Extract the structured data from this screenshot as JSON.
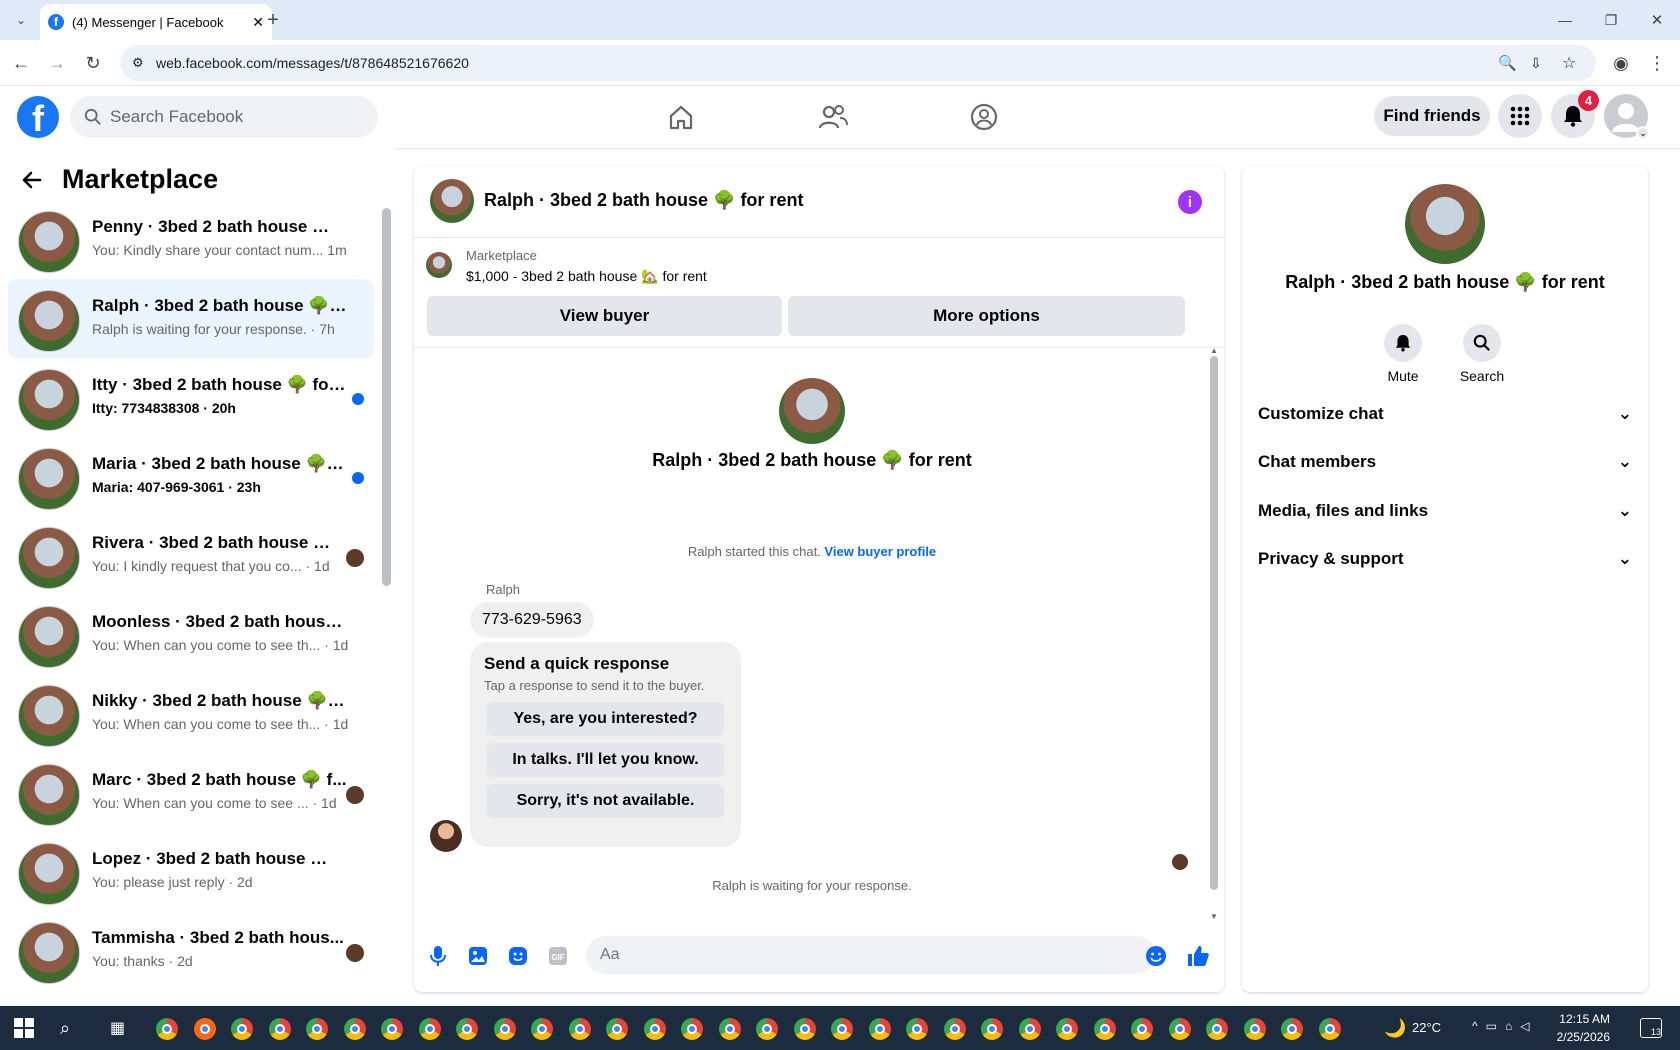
{
  "browser": {
    "tab_title": "(4) Messenger | Facebook",
    "url": "web.facebook.com/messages/t/878648521676620"
  },
  "header": {
    "search_placeholder": "Search Facebook",
    "find_friends": "Find friends",
    "notification_count": "4"
  },
  "sidebar": {
    "title": "Marketplace",
    "conversations": [
      {
        "name": "Penny · 3bed 2 bath house 🌳 fo...",
        "snippet": "You: Kindly share your contact num... 1m",
        "active": false,
        "unread": false,
        "indicator": "none"
      },
      {
        "name": "Ralph · 3bed 2 bath house 🌳 fo...",
        "snippet": "Ralph is waiting for your response. · 7h",
        "active": true,
        "unread": false,
        "indicator": "none"
      },
      {
        "name": "Itty · 3bed 2 bath house 🌳 for...",
        "snippet": "Itty: 7734838308 · 20h",
        "active": false,
        "unread": true,
        "indicator": "dot"
      },
      {
        "name": "Maria · 3bed 2 bath house 🌳 f...",
        "snippet": "Maria: 407-969-3061 · 23h",
        "active": false,
        "unread": true,
        "indicator": "dot"
      },
      {
        "name": "Rivera · 3bed 2 bath house 🌳 ...",
        "snippet": "You: I kindly request that you co... · 1d",
        "active": false,
        "unread": false,
        "indicator": "avatar"
      },
      {
        "name": "Moonless · 3bed 2 bath house ...",
        "snippet": "You: When can you come to see th... · 1d",
        "active": false,
        "unread": false,
        "indicator": "none"
      },
      {
        "name": "Nikky · 3bed 2 bath house 🌳 fo...",
        "snippet": "You: When can you come to see th... · 1d",
        "active": false,
        "unread": false,
        "indicator": "none"
      },
      {
        "name": "Marc · 3bed 2 bath house 🌳 f...",
        "snippet": "You: When can you come to see ... · 1d",
        "active": false,
        "unread": false,
        "indicator": "avatar"
      },
      {
        "name": "Lopez · 3bed 2 bath house 🌳 fo...",
        "snippet": "You: please just reply · 2d",
        "active": false,
        "unread": false,
        "indicator": "none"
      },
      {
        "name": "Tammisha · 3bed 2 bath hous...",
        "snippet": "You: thanks · 2d",
        "active": false,
        "unread": false,
        "indicator": "avatar"
      }
    ]
  },
  "chat": {
    "title": "Ralph · 3bed 2 bath house 🌳 for rent",
    "listing_source": "Marketplace",
    "listing_price": "$1,000 - 3bed 2 bath house 🏡 for rent",
    "view_buyer": "View buyer",
    "more_options": "More options",
    "thread_title": "Ralph · 3bed 2 bath house 🌳 for rent",
    "started_text": "Ralph started this chat.",
    "view_buyer_profile": "View buyer profile",
    "sender_name": "Ralph",
    "phone_message": "773-629-5963",
    "quick_title": "Send a quick response",
    "quick_sub": "Tap a response to send it to the buyer.",
    "quick_responses": [
      "Yes, are you interested?",
      "In talks. I'll let you know.",
      "Sorry, it's not available."
    ],
    "waiting_text": "Ralph is waiting for your response.",
    "composer_placeholder": "Aa"
  },
  "details": {
    "title": "Ralph · 3bed 2 bath house 🌳 for rent",
    "mute": "Mute",
    "search": "Search",
    "sections": [
      "Customize chat",
      "Chat members",
      "Media, files and links",
      "Privacy & support"
    ]
  },
  "taskbar": {
    "temperature": "22°C",
    "time": "12:15 AM",
    "date": "2/25/2026",
    "notification_count": "13"
  },
  "colors": {
    "accent": "#0866ff",
    "info": "#a033ff",
    "badge": "#e41e3f"
  }
}
